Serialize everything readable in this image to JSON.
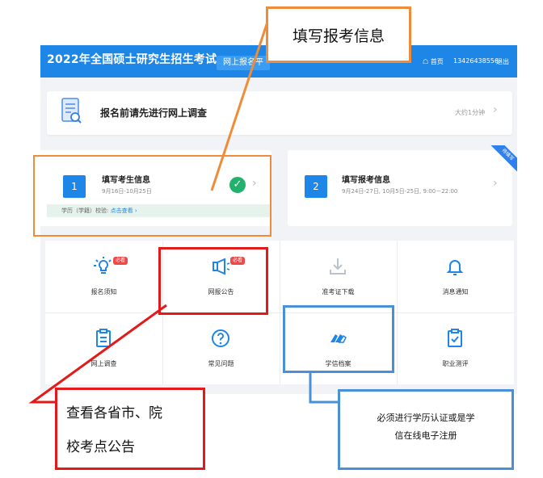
{
  "header": {
    "title": "2022年全国硕士研究生招生考试",
    "tab_label": "网上报名平",
    "home_label": "首页",
    "phone": "13426438556",
    "logout_label": "退出"
  },
  "survey": {
    "text": "报名前请先进行网上调查",
    "time": "大约1分钟"
  },
  "steps": [
    {
      "number": "1",
      "title": "填写考生信息",
      "date": "9月16日-10月25日",
      "completed": true,
      "verify_label": "学历（学籍）校验:",
      "verify_link": "点击查看"
    },
    {
      "number": "2",
      "title": "填写报考信息",
      "date": "9月24日-27日, 10月5日-25日, 9:00－22:00",
      "ribbon": "待填写"
    }
  ],
  "functions": [
    {
      "label": "报名须知",
      "icon": "lightbulb-icon",
      "badge": "必看"
    },
    {
      "label": "网报公告",
      "icon": "megaphone-icon",
      "badge": "必看"
    },
    {
      "label": "准考证下载",
      "icon": "download-icon"
    },
    {
      "label": "消息通知",
      "icon": "bell-icon"
    },
    {
      "label": "网上调查",
      "icon": "clipboard-icon"
    },
    {
      "label": "常见问题",
      "icon": "question-icon"
    },
    {
      "label": "学信档案",
      "icon": "hand-icon"
    },
    {
      "label": "职业测评",
      "icon": "checklist-icon"
    }
  ],
  "annotations": {
    "top": "填写报考信息",
    "bottom_left_line1": "查看各省市、院",
    "bottom_left_line2": "校考点公告",
    "bottom_right_line1": "必须进行学历认证或是学",
    "bottom_right_line2": "信在线电子注册"
  },
  "colors": {
    "header": "#1e86e6",
    "accent": "#1e86e6",
    "success": "#23b26d",
    "badge": "#f04848",
    "annotation_orange": "#ef8c3a",
    "annotation_red": "#e21a1a",
    "annotation_blue": "#4a90d9"
  }
}
